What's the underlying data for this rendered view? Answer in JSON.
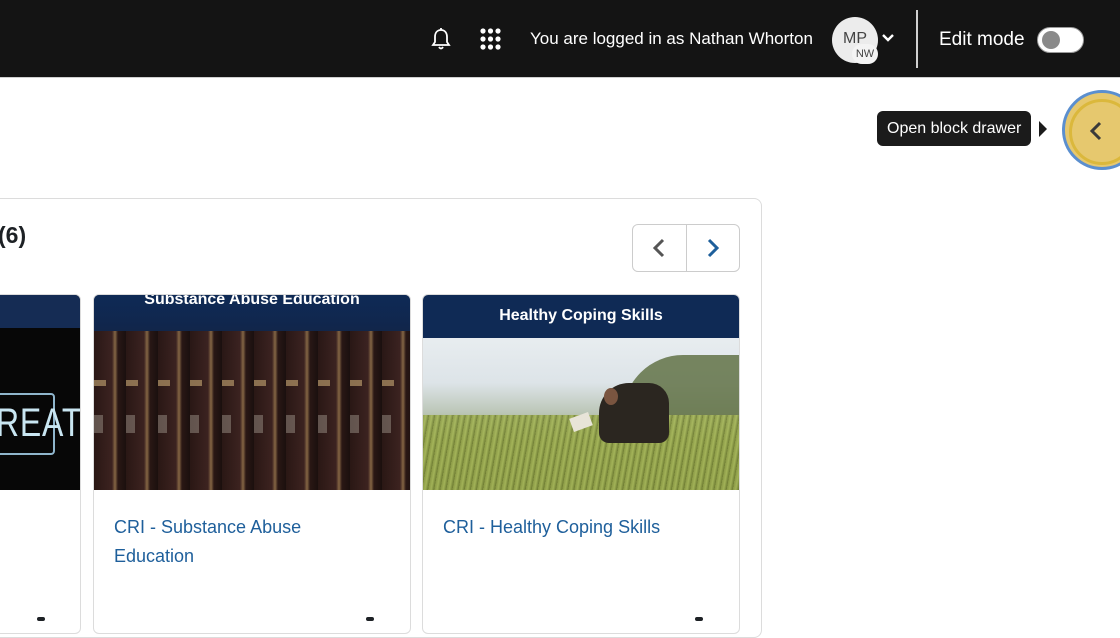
{
  "header": {
    "user_text": "You are logged in as Nathan Whorton",
    "avatar_initials": "MP",
    "avatar_badge": "NW",
    "edit_mode_label": "Edit mode"
  },
  "tooltip": {
    "text": "Open block drawer"
  },
  "courses": {
    "count_label": "(6)",
    "cards": [
      {
        "title": "",
        "image_text": "REAT",
        "image_icon": "neon-sign-image"
      },
      {
        "title": "CRI - Substance Abuse Education",
        "banner": "Substance Abuse Education",
        "image_icon": "books-image"
      },
      {
        "title": "CRI - Healthy Coping Skills",
        "banner": "Healthy Coping Skills",
        "image_icon": "reading-man-image"
      }
    ]
  },
  "colors": {
    "navbar": "#141414",
    "link": "#1e5f9b",
    "drawer_button": "#e6c86e"
  }
}
